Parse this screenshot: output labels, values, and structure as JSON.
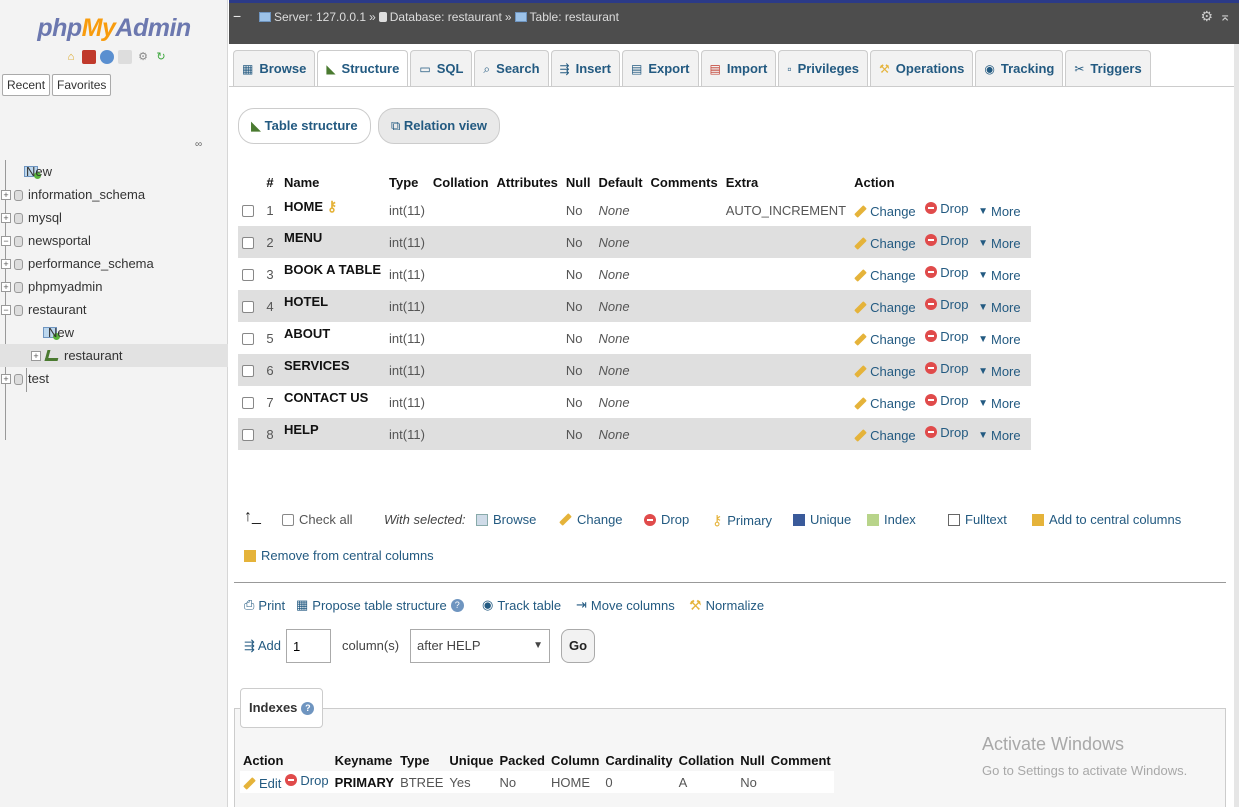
{
  "nav": {
    "logo_php": "php",
    "logo_my": "My",
    "logo_admin": "Admin",
    "tabs": [
      "Recent",
      "Favorites"
    ],
    "tree": [
      {
        "label": "New",
        "kind": "new"
      },
      {
        "label": "information_schema",
        "kind": "db"
      },
      {
        "label": "mysql",
        "kind": "db"
      },
      {
        "label": "newsportal",
        "kind": "db"
      },
      {
        "label": "performance_schema",
        "kind": "db"
      },
      {
        "label": "phpmyadmin",
        "kind": "db"
      },
      {
        "label": "restaurant",
        "kind": "db"
      },
      {
        "label": "New",
        "kind": "new"
      },
      {
        "label": "restaurant",
        "kind": "table"
      },
      {
        "label": "test",
        "kind": "db"
      }
    ]
  },
  "breadcrumb": {
    "server": "Server: 127.0.0.1",
    "database": "Database: restaurant",
    "table": "Table: restaurant",
    "sep": "»"
  },
  "tabs": [
    "Browse",
    "Structure",
    "SQL",
    "Search",
    "Insert",
    "Export",
    "Import",
    "Privileges",
    "Operations",
    "Tracking",
    "Triggers"
  ],
  "subtabs": [
    "Table structure",
    "Relation view"
  ],
  "structure": {
    "headers": [
      "#",
      "Name",
      "Type",
      "Collation",
      "Attributes",
      "Null",
      "Default",
      "Comments",
      "Extra",
      "Action"
    ],
    "rows": [
      {
        "num": "1",
        "name": "HOME",
        "type": "int(11)",
        "null": "No",
        "default": "None",
        "extra": "AUTO_INCREMENT"
      },
      {
        "num": "2",
        "name": "MENU",
        "type": "int(11)",
        "null": "No",
        "default": "None",
        "extra": ""
      },
      {
        "num": "3",
        "name": "BOOK A TABLE",
        "type": "int(11)",
        "null": "No",
        "default": "None",
        "extra": ""
      },
      {
        "num": "4",
        "name": "HOTEL",
        "type": "int(11)",
        "null": "No",
        "default": "None",
        "extra": ""
      },
      {
        "num": "5",
        "name": "ABOUT",
        "type": "int(11)",
        "null": "No",
        "default": "None",
        "extra": ""
      },
      {
        "num": "6",
        "name": "SERVICES",
        "type": "int(11)",
        "null": "No",
        "default": "None",
        "extra": ""
      },
      {
        "num": "7",
        "name": "CONTACT US",
        "type": "int(11)",
        "null": "No",
        "default": "None",
        "extra": ""
      },
      {
        "num": "8",
        "name": "HELP",
        "type": "int(11)",
        "null": "No",
        "default": "None",
        "extra": ""
      }
    ],
    "actions": {
      "change": "Change",
      "drop": "Drop",
      "more": "More"
    }
  },
  "bulk": {
    "check_all": "Check all",
    "with_selected": "With selected:",
    "browse": "Browse",
    "change": "Change",
    "drop": "Drop",
    "primary": "Primary",
    "unique": "Unique",
    "index": "Index",
    "fulltext": "Fulltext",
    "add_central": "Add to central columns",
    "remove_central": "Remove from central columns"
  },
  "tools": {
    "print": "Print",
    "propose": "Propose table structure",
    "track": "Track table",
    "move": "Move columns",
    "normalize": "Normalize"
  },
  "add": {
    "label": "Add",
    "count": "1",
    "unit": "column(s)",
    "position": "after HELP",
    "go": "Go"
  },
  "indexes": {
    "title": "Indexes",
    "headers": [
      "Action",
      "Keyname",
      "Type",
      "Unique",
      "Packed",
      "Column",
      "Cardinality",
      "Collation",
      "Null",
      "Comment"
    ],
    "row": {
      "edit": "Edit",
      "drop": "Drop",
      "keyname": "PRIMARY",
      "type": "BTREE",
      "unique": "Yes",
      "packed": "No",
      "column": "HOME",
      "cardinality": "0",
      "collation": "A",
      "null": "No",
      "comment": ""
    }
  },
  "watermark": {
    "title": "Activate Windows",
    "subtitle": "Go to Settings to activate Windows."
  },
  "colors": {
    "link": "#235a81",
    "topbar": "#4d4d4d",
    "row_alt": "#dfdfdf"
  }
}
